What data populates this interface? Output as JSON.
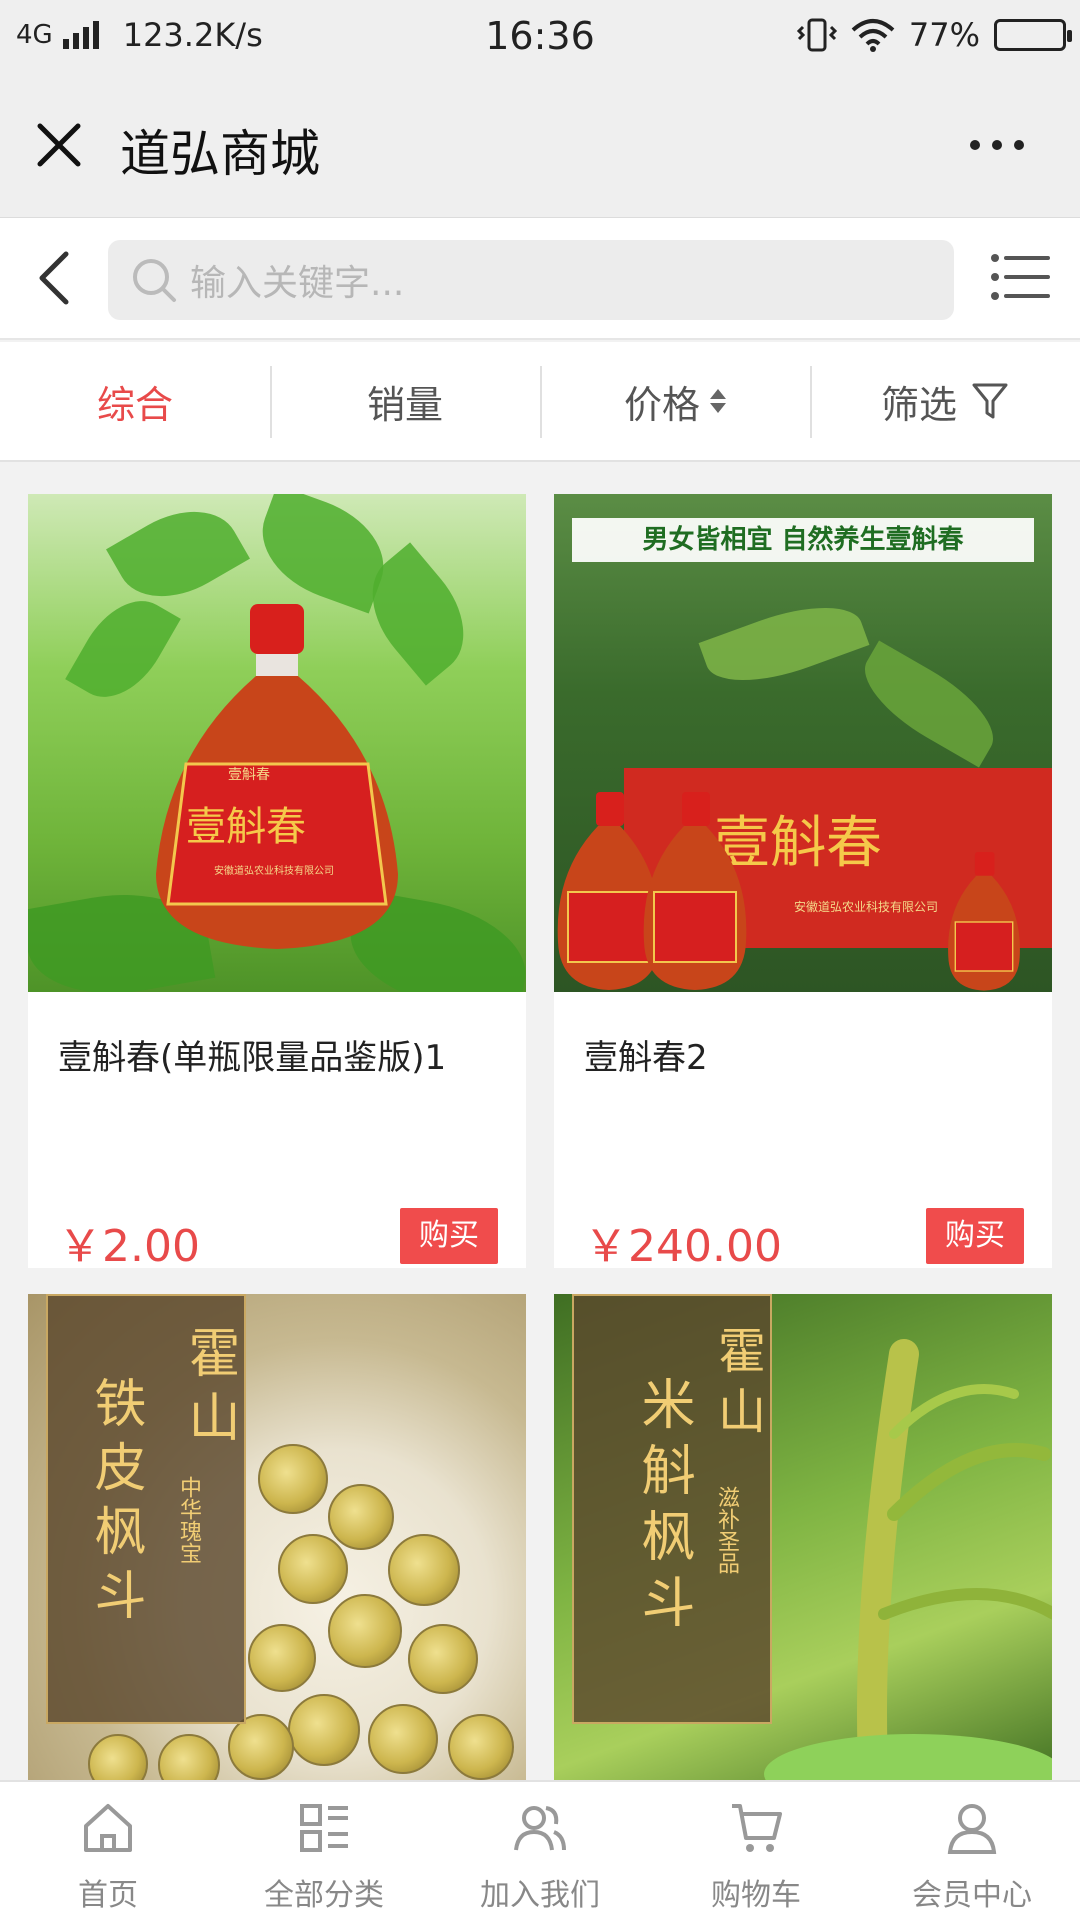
{
  "status": {
    "network": "4G",
    "speed": "123.2K/s",
    "time": "16:36",
    "battery": "77%",
    "battery_level": 0.77
  },
  "header": {
    "title": "道弘商城"
  },
  "search": {
    "placeholder": "输入关键字..."
  },
  "sort": {
    "tabs": [
      "综合",
      "销量",
      "价格",
      "筛选"
    ],
    "active": "综合"
  },
  "products": [
    {
      "name": "壹斛春(单瓶限量品鉴版)1",
      "price": "￥2.00",
      "buy_label": "购买",
      "image_text": [
        "壹斛春",
        "壹斛春",
        "安徽道弘农业科技有限公司"
      ]
    },
    {
      "name": "壹斛春2",
      "price": "￥240.00",
      "buy_label": "购买",
      "image_text": [
        "男女皆相宜  自然养生壹斛春",
        "壹斛春",
        "安徽道弘农业科技有限公司"
      ]
    },
    {
      "image_text": [
        "霍山",
        "铁皮枫斗",
        "中华瑰宝"
      ]
    },
    {
      "image_text": [
        "霍山",
        "米斛枫斗",
        "滋补圣品"
      ]
    }
  ],
  "tabbar": {
    "items": [
      "首页",
      "全部分类",
      "加入我们",
      "购物车",
      "会员中心"
    ]
  },
  "colors": {
    "accent": "#e84a4a",
    "buy_button": "#f04c4c",
    "background": "#f2f2f2"
  }
}
